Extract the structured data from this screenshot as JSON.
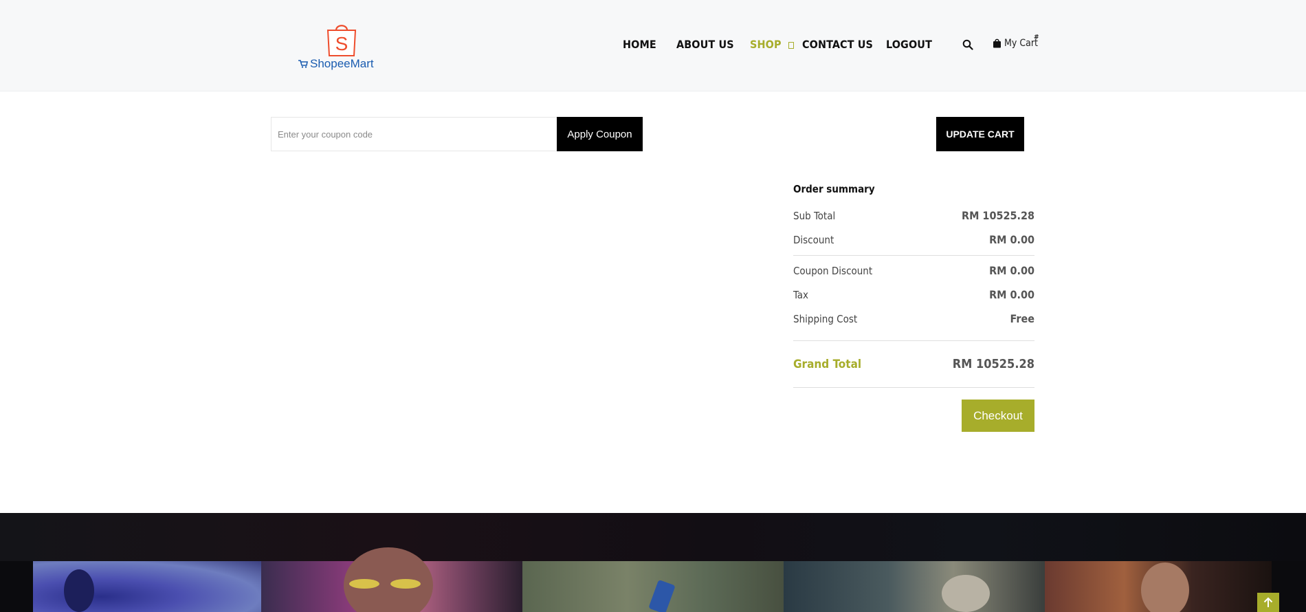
{
  "brand": {
    "name": "ShopeeMart",
    "logo_letter": "S",
    "colors": {
      "bag": "#ee4d2d",
      "text": "#1a5cb0"
    }
  },
  "nav": {
    "items": [
      {
        "label": "HOME",
        "active": false
      },
      {
        "label": "ABOUT US",
        "active": false
      },
      {
        "label": "SHOP",
        "active": true
      },
      {
        "label": "CONTACT US",
        "active": false
      },
      {
        "label": "LOGOUT",
        "active": false
      }
    ],
    "search_icon": "search-icon",
    "cart": {
      "label": "My Cart",
      "count": "#"
    }
  },
  "coupon": {
    "placeholder": "Enter your coupon code",
    "value": "",
    "apply_label": "Apply Coupon"
  },
  "update_cart_label": "UPDATE CART",
  "summary": {
    "title": "Order summary",
    "rows": [
      {
        "label": "Sub Total",
        "value": "RM 10525.28"
      },
      {
        "label": "Discount",
        "value": "RM 0.00"
      },
      {
        "label": "Coupon Discount",
        "value": "RM 0.00"
      },
      {
        "label": "Tax",
        "value": "RM 0.00"
      },
      {
        "label": "Shipping Cost",
        "value": "Free"
      }
    ],
    "grand_total": {
      "label": "Grand Total",
      "value": "RM 10525.28"
    },
    "checkout_label": "Checkout"
  },
  "theme": {
    "accent": "#a7ad2b",
    "dark": "#000000"
  },
  "footer": {
    "gallery_icons": [
      "instagram-photo-1",
      "instagram-photo-2",
      "instagram-photo-3",
      "instagram-photo-4",
      "instagram-photo-5"
    ],
    "scroll_top_icon": "arrow-up-icon"
  }
}
